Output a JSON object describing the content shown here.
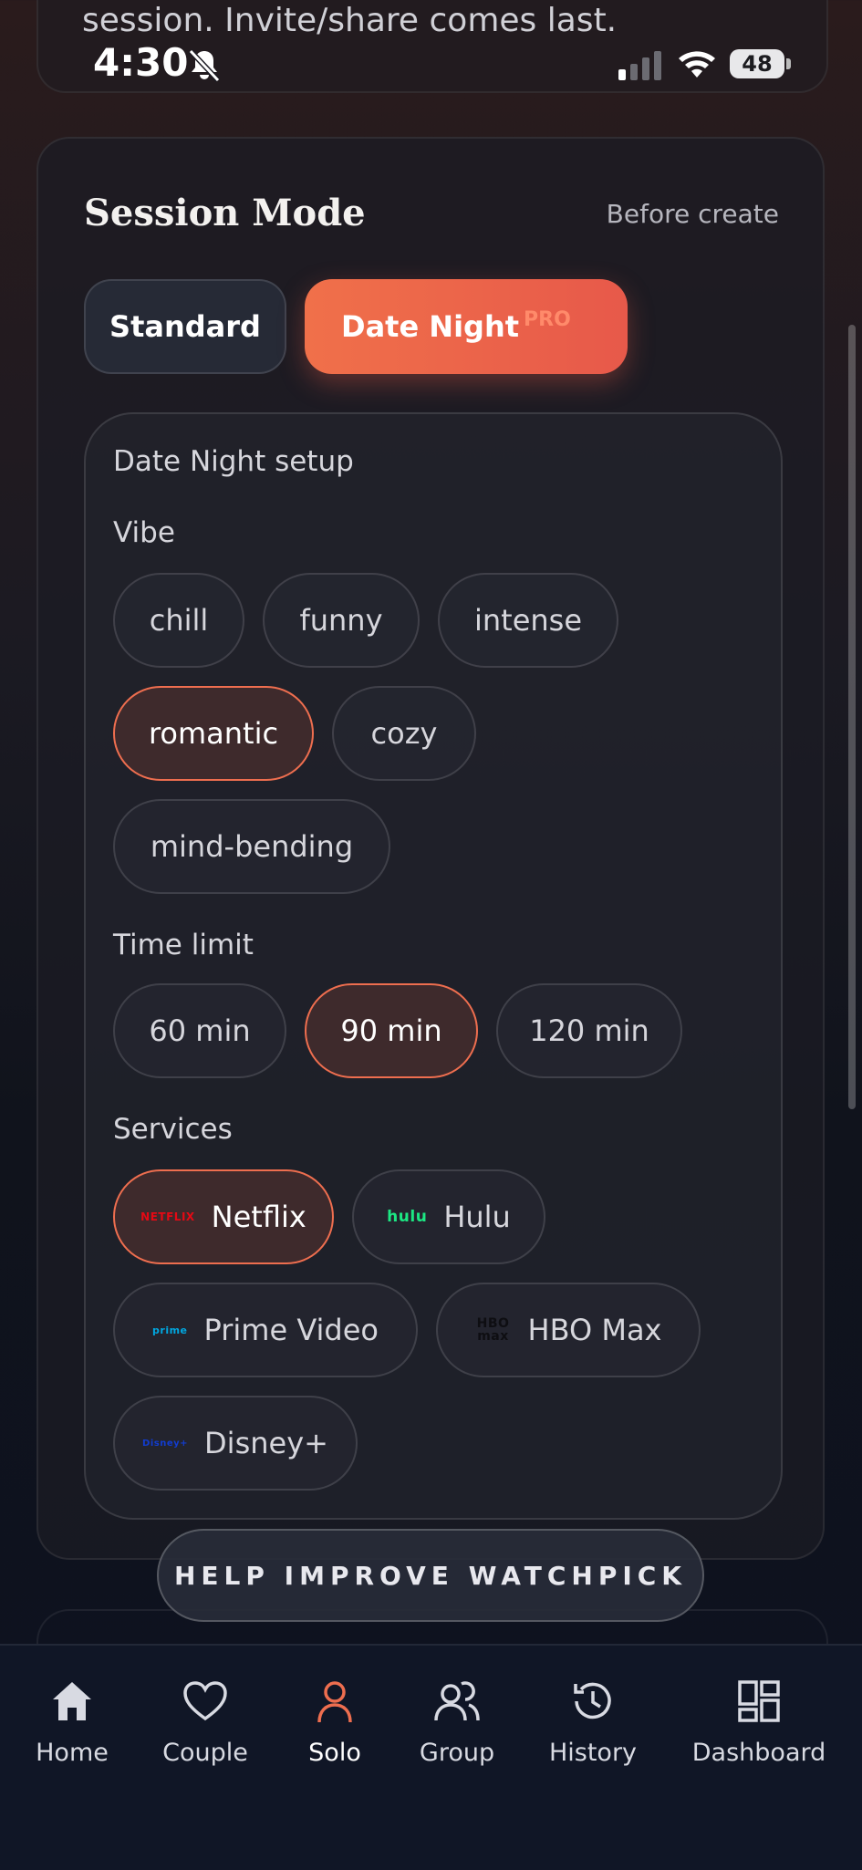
{
  "intro_text": "session. Invite/share comes last.",
  "status_bar": {
    "time": "4:30",
    "battery": "48"
  },
  "session_mode": {
    "title": "Session Mode",
    "subtitle": "Before create",
    "modes": [
      {
        "label": "Standard",
        "selected": false
      },
      {
        "label": "Date Night",
        "badge": "PRO",
        "selected": true
      }
    ]
  },
  "date_night": {
    "heading": "Date Night setup",
    "vibe": {
      "label": "Vibe",
      "options": [
        "chill",
        "funny",
        "intense",
        "romantic",
        "cozy",
        "mind-bending"
      ],
      "selected": "romantic"
    },
    "time_limit": {
      "label": "Time limit",
      "options": [
        "60 min",
        "90 min",
        "120 min"
      ],
      "selected": "90 min"
    },
    "services": {
      "label": "Services",
      "options": [
        {
          "name": "Netflix",
          "logo": "NETFLIX",
          "logo_color": "#e50914",
          "selected": true
        },
        {
          "name": "Hulu",
          "logo": "hulu",
          "logo_color": "#1ce783",
          "selected": false
        },
        {
          "name": "Prime Video",
          "logo": "prime",
          "logo_color": "#00a8e1",
          "selected": false
        },
        {
          "name": "HBO Max",
          "logo": "HBO max",
          "logo_color": "#1a1a1a",
          "selected": false
        },
        {
          "name": "Disney+",
          "logo": "Disney+",
          "logo_color": "#113ccf",
          "selected": false
        }
      ]
    }
  },
  "help_banner": "HELP IMPROVE WATCHPICK",
  "tabs": [
    {
      "label": "Home",
      "icon": "home-icon",
      "active": false
    },
    {
      "label": "Couple",
      "icon": "heart-icon",
      "active": false
    },
    {
      "label": "Solo",
      "icon": "person-icon",
      "active": true
    },
    {
      "label": "Group",
      "icon": "group-icon",
      "active": false
    },
    {
      "label": "History",
      "icon": "history-icon",
      "active": false
    },
    {
      "label": "Dashboard",
      "icon": "dashboard-icon",
      "active": false
    }
  ],
  "colors": {
    "accent": "#ee6e4f",
    "accent_gradient_end": "#e7594a",
    "background": "#10131c"
  }
}
